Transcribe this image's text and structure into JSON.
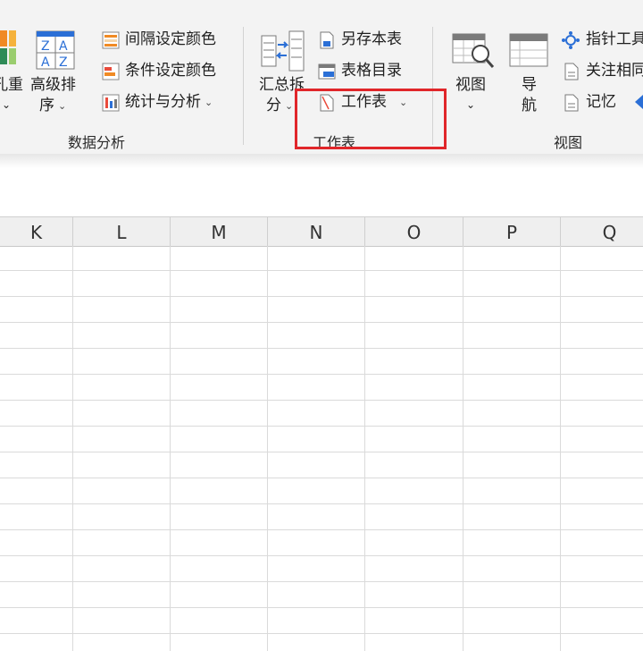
{
  "ribbon": {
    "partial_left": {
      "line1": "孔重",
      "chevron": "⌄"
    },
    "advanced_sort": {
      "line1": "高级排",
      "line2": "序"
    },
    "data_analysis_items": [
      {
        "label": "间隔设定颜色",
        "icon": "interval-color-icon"
      },
      {
        "label": "条件设定颜色",
        "icon": "condition-color-icon"
      },
      {
        "label": "统计与分析",
        "icon": "statistics-icon"
      }
    ],
    "data_analysis_group_label": "数据分析",
    "summarize_split": {
      "line1": "汇总拆",
      "line2": "分"
    },
    "worksheet_items": [
      {
        "label": "另存本表",
        "icon": "save-sheet-icon"
      },
      {
        "label": "表格目录",
        "icon": "sheet-directory-icon"
      },
      {
        "label": "工作表",
        "icon": "worksheet-icon"
      }
    ],
    "worksheet_group_label": "工作表",
    "view_button": {
      "label": "视图"
    },
    "navigate_button": {
      "line1": "导",
      "line2": "航"
    },
    "view_items": [
      {
        "label": "指针工具",
        "icon": "pointer-tool-icon"
      },
      {
        "label": "关注相同",
        "icon": "focus-same-icon"
      },
      {
        "label": "记忆",
        "icon": "memory-icon"
      }
    ],
    "view_group_label": "视图"
  },
  "columns": [
    "K",
    "L",
    "M",
    "N",
    "O",
    "P",
    "Q"
  ],
  "colors": {
    "highlight": "#e0262a",
    "ribbon_bg": "#f3f3f3",
    "header_bg": "#efefef",
    "accent_blue": "#2b6fd6"
  }
}
